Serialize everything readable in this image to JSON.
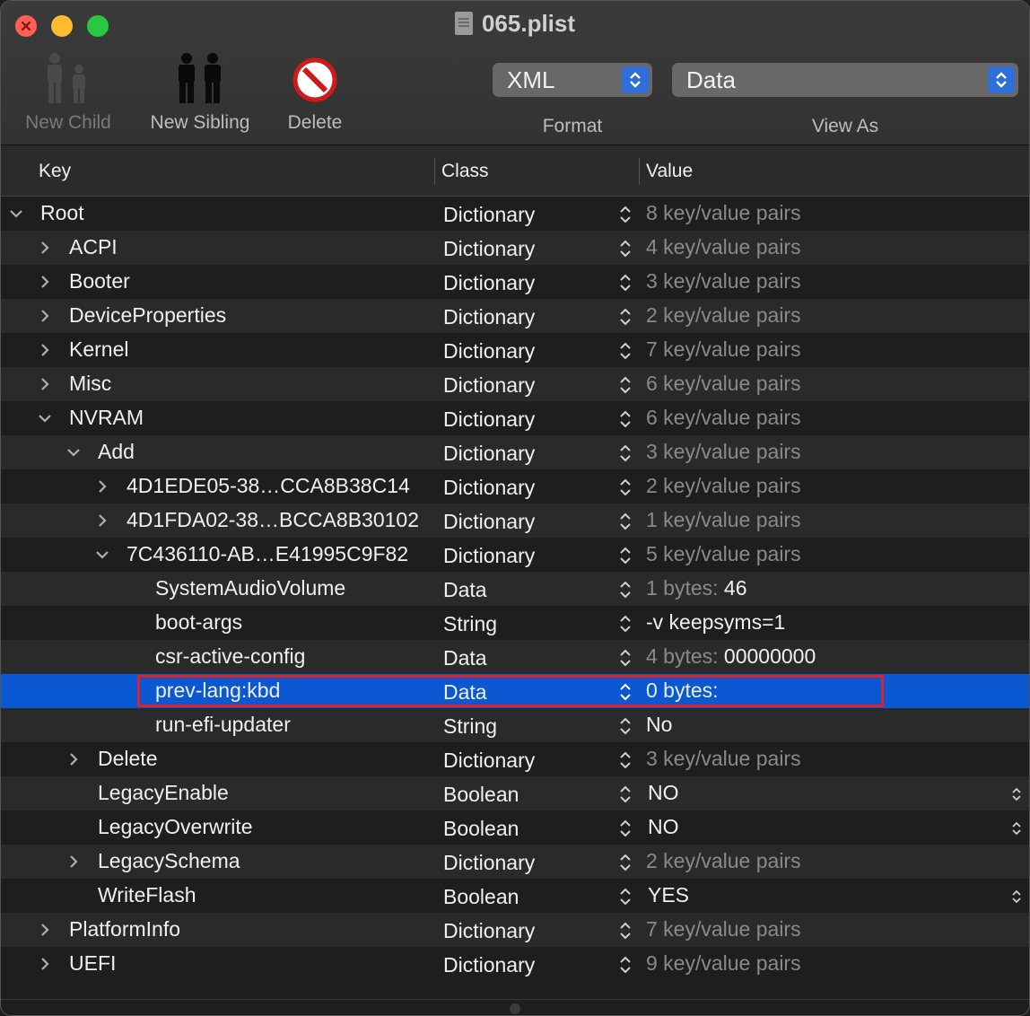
{
  "window": {
    "title": "065.plist"
  },
  "toolbar": {
    "new_child": "New Child",
    "new_sibling": "New Sibling",
    "delete": "Delete",
    "format_value": "XML",
    "format_label": "Format",
    "viewas_value": "Data",
    "viewas_label": "View As"
  },
  "columns": {
    "key": "Key",
    "class": "Class",
    "value": "Value"
  },
  "rows": [
    {
      "key": "Root",
      "class": "Dictionary",
      "value": "8 key/value pairs",
      "depth": 0,
      "disclosure": "expanded",
      "value_style": "dim"
    },
    {
      "key": "ACPI",
      "class": "Dictionary",
      "value": "4 key/value pairs",
      "depth": 1,
      "disclosure": "collapsed",
      "value_style": "dim"
    },
    {
      "key": "Booter",
      "class": "Dictionary",
      "value": "3 key/value pairs",
      "depth": 1,
      "disclosure": "collapsed",
      "value_style": "dim"
    },
    {
      "key": "DeviceProperties",
      "class": "Dictionary",
      "value": "2 key/value pairs",
      "depth": 1,
      "disclosure": "collapsed",
      "value_style": "dim"
    },
    {
      "key": "Kernel",
      "class": "Dictionary",
      "value": "7 key/value pairs",
      "depth": 1,
      "disclosure": "collapsed",
      "value_style": "dim"
    },
    {
      "key": "Misc",
      "class": "Dictionary",
      "value": "6 key/value pairs",
      "depth": 1,
      "disclosure": "collapsed",
      "value_style": "dim"
    },
    {
      "key": "NVRAM",
      "class": "Dictionary",
      "value": "6 key/value pairs",
      "depth": 1,
      "disclosure": "expanded",
      "value_style": "dim"
    },
    {
      "key": "Add",
      "class": "Dictionary",
      "value": "3 key/value pairs",
      "depth": 2,
      "disclosure": "expanded",
      "value_style": "dim"
    },
    {
      "key": "4D1EDE05-38…CCA8B38C14",
      "class": "Dictionary",
      "value": "2 key/value pairs",
      "depth": 3,
      "disclosure": "collapsed",
      "value_style": "dim"
    },
    {
      "key": "4D1FDA02-38…BCCA8B30102",
      "class": "Dictionary",
      "value": "1 key/value pairs",
      "depth": 3,
      "disclosure": "collapsed",
      "value_style": "dim"
    },
    {
      "key": "7C436110-AB…E41995C9F82",
      "class": "Dictionary",
      "value": "5 key/value pairs",
      "depth": 3,
      "disclosure": "expanded",
      "value_style": "dim"
    },
    {
      "key": "SystemAudioVolume",
      "class": "Data",
      "value_type": "1 bytes:",
      "value": "46",
      "depth": 4,
      "disclosure": "none",
      "value_style": "data"
    },
    {
      "key": "boot-args",
      "class": "String",
      "value": "-v keepsyms=1",
      "depth": 4,
      "disclosure": "none",
      "value_style": "bright"
    },
    {
      "key": "csr-active-config",
      "class": "Data",
      "value_type": "4 bytes:",
      "value": "00000000",
      "depth": 4,
      "disclosure": "none",
      "value_style": "data"
    },
    {
      "key": "prev-lang:kbd",
      "class": "Data",
      "value_type": "0 bytes:",
      "value": "",
      "depth": 4,
      "disclosure": "none",
      "value_style": "data",
      "selected": true
    },
    {
      "key": "run-efi-updater",
      "class": "String",
      "value": "No",
      "depth": 4,
      "disclosure": "none",
      "value_style": "bright"
    },
    {
      "key": "Delete",
      "class": "Dictionary",
      "value": "3 key/value pairs",
      "depth": 2,
      "disclosure": "collapsed",
      "value_style": "dim"
    },
    {
      "key": "LegacyEnable",
      "class": "Boolean",
      "value": "NO",
      "depth": 2,
      "disclosure": "none",
      "value_style": "bright",
      "value_popup": true
    },
    {
      "key": "LegacyOverwrite",
      "class": "Boolean",
      "value": "NO",
      "depth": 2,
      "disclosure": "none",
      "value_style": "bright",
      "value_popup": true
    },
    {
      "key": "LegacySchema",
      "class": "Dictionary",
      "value": "2 key/value pairs",
      "depth": 2,
      "disclosure": "collapsed",
      "value_style": "dim"
    },
    {
      "key": "WriteFlash",
      "class": "Boolean",
      "value": "YES",
      "depth": 2,
      "disclosure": "none",
      "value_style": "bright",
      "value_popup": true
    },
    {
      "key": "PlatformInfo",
      "class": "Dictionary",
      "value": "7 key/value pairs",
      "depth": 1,
      "disclosure": "collapsed",
      "value_style": "dim"
    },
    {
      "key": "UEFI",
      "class": "Dictionary",
      "value": "9 key/value pairs",
      "depth": 1,
      "disclosure": "collapsed",
      "value_style": "dim"
    }
  ],
  "colors": {
    "selection": "#0a58d2",
    "highlight_box": "#e0202a",
    "accent": "#2f6fdc"
  }
}
